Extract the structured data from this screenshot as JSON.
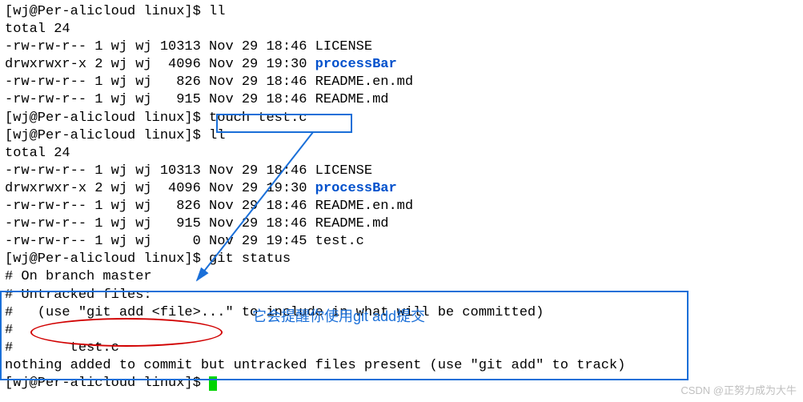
{
  "prompt1": "[wj@Per-alicloud linux]$ ",
  "cmd_ll1": "ll",
  "total1": "total 24",
  "ls1": {
    "r1": "-rw-rw-r-- 1 wj wj 10313 Nov 29 18:46 LICENSE",
    "r2a": "drwxrwxr-x 2 wj wj  4096 Nov 29 19:30 ",
    "r2b": "processBar",
    "r3": "-rw-rw-r-- 1 wj wj   826 Nov 29 18:46 README.en.md",
    "r4": "-rw-rw-r-- 1 wj wj   915 Nov 29 18:46 README.md"
  },
  "prompt2": "[wj@Per-alicloud linux]$ ",
  "cmd_touch": "touch test.c",
  "prompt3": "[wj@Per-alicloud linux]$ ",
  "cmd_ll2": "ll",
  "total2": "total 24",
  "ls2": {
    "r1": "-rw-rw-r-- 1 wj wj 10313 Nov 29 18:46 LICENSE",
    "r2a": "drwxrwxr-x 2 wj wj  4096 Nov 29 19:30 ",
    "r2b": "processBar",
    "r3": "-rw-rw-r-- 1 wj wj   826 Nov 29 18:46 README.en.md",
    "r4": "-rw-rw-r-- 1 wj wj   915 Nov 29 18:46 README.md",
    "r5": "-rw-rw-r-- 1 wj wj     0 Nov 29 19:45 test.c"
  },
  "prompt4": "[wj@Per-alicloud linux]$ ",
  "cmd_status": "git status",
  "status": {
    "l1": "# On branch master",
    "l2": "# Untracked files:",
    "l3": "#   (use \"git add <file>...\" to include in what will be committed)",
    "l4": "#",
    "l5": "#       test.c",
    "l6": "nothing added to commit but untracked files present (use \"git add\" to track)"
  },
  "prompt5": "[wj@Per-alicloud linux]$ ",
  "annotation": "它会提醒你使用git add提交",
  "watermark": "CSDN @正努力成为大牛",
  "colors": {
    "dir": "#0050cc",
    "box": "#1a6fd8",
    "ellipse": "#d10000",
    "cursor": "#00d400"
  }
}
